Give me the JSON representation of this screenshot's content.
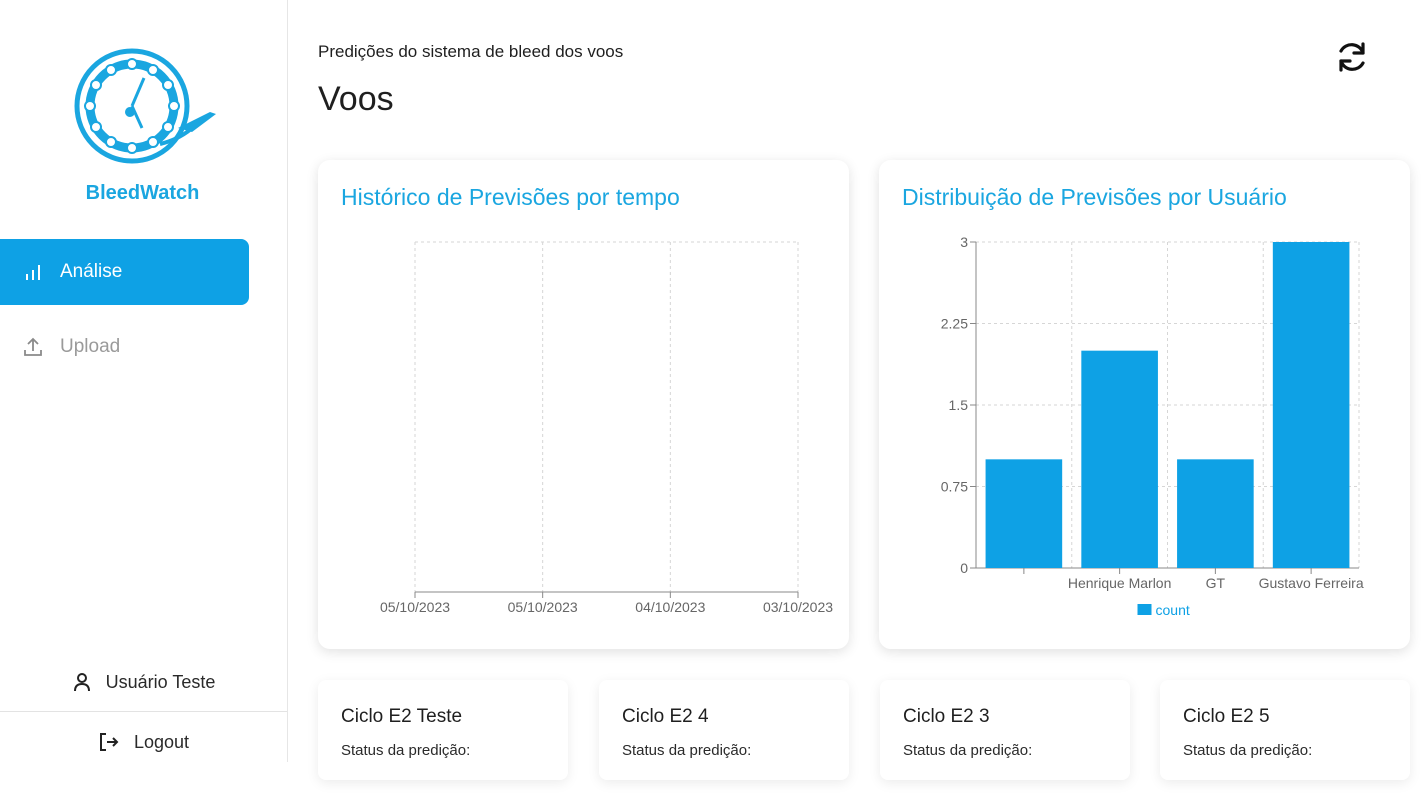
{
  "sidebar": {
    "brand": "BleedWatch",
    "nav": [
      {
        "label": "Análise",
        "icon": "bar-chart-icon",
        "active": true
      },
      {
        "label": "Upload",
        "icon": "upload-icon",
        "active": false
      }
    ],
    "user": {
      "label": "Usuário Teste",
      "icon": "user-icon"
    },
    "logout": {
      "label": "Logout",
      "icon": "logout-icon"
    }
  },
  "header": {
    "subtitle": "Predições do sistema de bleed dos voos",
    "title": "Voos",
    "refresh_icon": "refresh-icon"
  },
  "colors": {
    "accent": "#0ea1e5",
    "title": "#1aa6e0",
    "grid": "#d6d6d6"
  },
  "chart_data": [
    {
      "type": "line",
      "title": "Histórico de Previsões por tempo",
      "categories": [
        "05/10/2023",
        "05/10/2023",
        "04/10/2023",
        "03/10/2023"
      ],
      "series": [],
      "grid": true
    },
    {
      "type": "bar",
      "title": "Distribuição de Previsões por Usuário",
      "categories": [
        "",
        "Henrique Marlon",
        "GT",
        "Gustavo Ferreira"
      ],
      "series": [
        {
          "name": "count",
          "values": [
            1,
            2,
            1,
            3
          ]
        }
      ],
      "yticks": [
        "0",
        "0.75",
        "1.5",
        "2.25",
        "3"
      ],
      "ylim": [
        0,
        3
      ],
      "grid": true,
      "legend": "bottom"
    }
  ],
  "cards": [
    {
      "title": "Ciclo E2 Teste",
      "status": "Status da predição:"
    },
    {
      "title": "Ciclo E2 4",
      "status": "Status da predição:"
    },
    {
      "title": "Ciclo E2 3",
      "status": "Status da predição:"
    },
    {
      "title": "Ciclo E2 5",
      "status": "Status da predição:"
    }
  ]
}
